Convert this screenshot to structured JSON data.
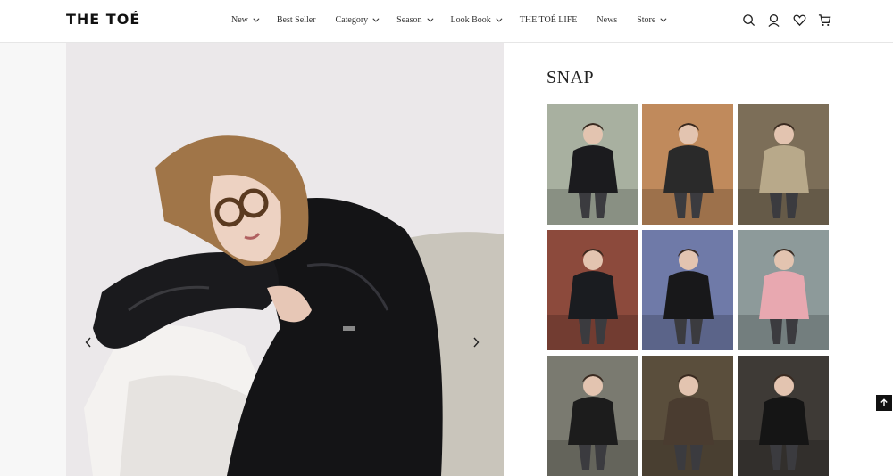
{
  "header": {
    "logo": "THE TOÉ",
    "nav": [
      {
        "label": "New",
        "has_dropdown": true
      },
      {
        "label": "Best Seller",
        "has_dropdown": false
      },
      {
        "label": "Category",
        "has_dropdown": true
      },
      {
        "label": "Season",
        "has_dropdown": true
      },
      {
        "label": "Look Book",
        "has_dropdown": true
      },
      {
        "label": "THE TOÉ LIFE",
        "has_dropdown": false
      },
      {
        "label": "News",
        "has_dropdown": false
      },
      {
        "label": "Store",
        "has_dropdown": true
      }
    ],
    "icons": [
      "search-icon",
      "user-icon",
      "heart-icon",
      "cart-icon"
    ]
  },
  "hero": {
    "prev_icon": "chevron-left-icon",
    "next_icon": "chevron-right-icon"
  },
  "snap": {
    "title": "SNAP",
    "photos": [
      {
        "name": "snap-photo-1",
        "bg": "#a8b0a0",
        "coat": "#1b1b1e"
      },
      {
        "name": "snap-photo-2",
        "bg": "#c08a5c",
        "coat": "#2a2a2a"
      },
      {
        "name": "snap-photo-3",
        "bg": "#7c6e58",
        "coat": "#b8a98a"
      },
      {
        "name": "snap-photo-4",
        "bg": "#8c4a3c",
        "coat": "#1a1c20"
      },
      {
        "name": "snap-photo-5",
        "bg": "#6f7aa8",
        "coat": "#18181a"
      },
      {
        "name": "snap-photo-6",
        "bg": "#8d9a9a",
        "coat": "#e8a8b0"
      },
      {
        "name": "snap-photo-7",
        "bg": "#7a7a70",
        "coat": "#1c1c1c"
      },
      {
        "name": "snap-photo-8",
        "bg": "#5a4e3c",
        "coat": "#4a3c30"
      },
      {
        "name": "snap-photo-9",
        "bg": "#3e3a36",
        "coat": "#151515"
      }
    ]
  },
  "back_to_top_icon": "arrow-up-icon",
  "colors": {
    "accent": "#111111",
    "background": "#ffffff"
  }
}
